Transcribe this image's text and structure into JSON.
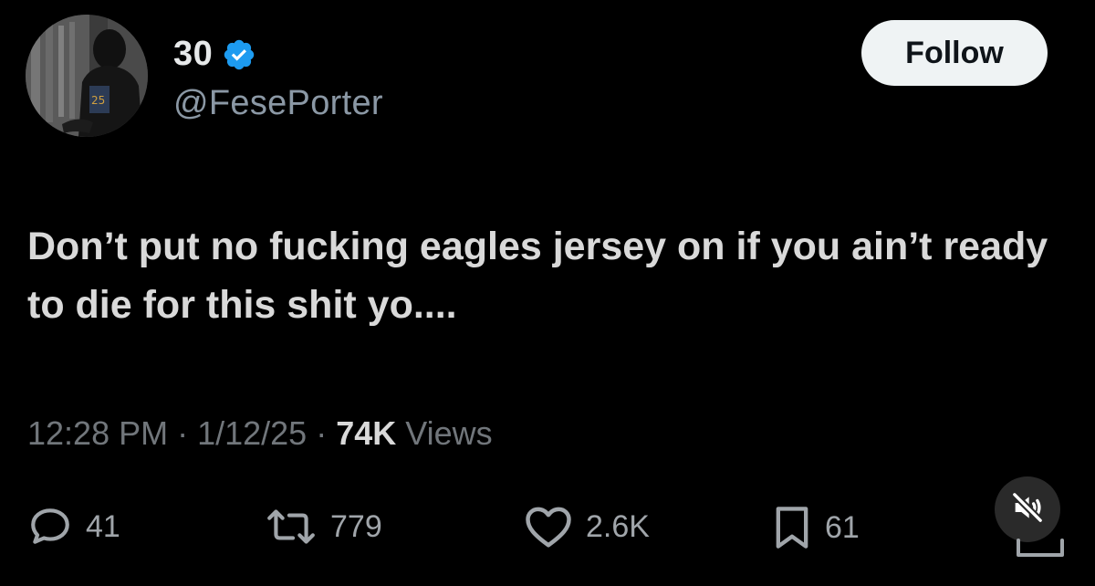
{
  "user": {
    "display_name": "30",
    "handle": "@FesePorter",
    "verified": true,
    "avatar_icon": "profile-photo"
  },
  "follow_button": {
    "label": "Follow"
  },
  "tweet": {
    "text": "Don’t put no fucking eagles jersey on if you ain’t ready to die for this shit yo....",
    "time": "12:28 PM",
    "date": "1/12/25",
    "views_count": "74K",
    "views_label": "Views"
  },
  "actions": {
    "replies": "41",
    "retweets": "779",
    "likes": "2.6K",
    "bookmarks": "61"
  },
  "colors": {
    "background": "#000000",
    "verified_badge": "#1d9bf0",
    "muted_text": "#71767b",
    "follow_bg": "#eff3f4"
  },
  "icons": {
    "reply": "speech-bubble-icon",
    "retweet": "retweet-arrows-icon",
    "like": "heart-icon",
    "bookmark": "bookmark-icon",
    "mute": "speaker-muted-icon",
    "share": "share-tray-icon",
    "verified": "verified-badge-icon"
  }
}
